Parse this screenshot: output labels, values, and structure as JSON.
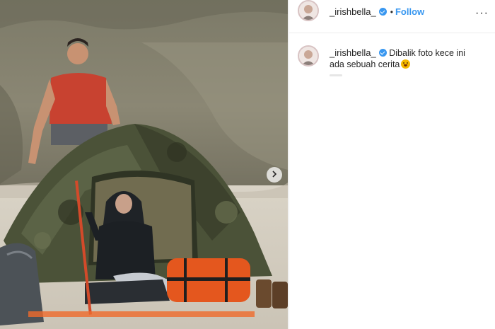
{
  "post": {
    "username": "_irishbella_",
    "follow_label": "Follow",
    "dot": "•",
    "more_label": "···",
    "caption_line1": "Dibalik foto kece ini",
    "caption_line2": "ada sebuah cerita"
  },
  "icons": {
    "verified": "verified-badge-icon",
    "carousel": "chevron-right-icon",
    "caption_emoji": "grinning-face-icon"
  },
  "colors": {
    "accent": "#3897f0",
    "text": "#262626",
    "border": "#e3e3e3"
  }
}
